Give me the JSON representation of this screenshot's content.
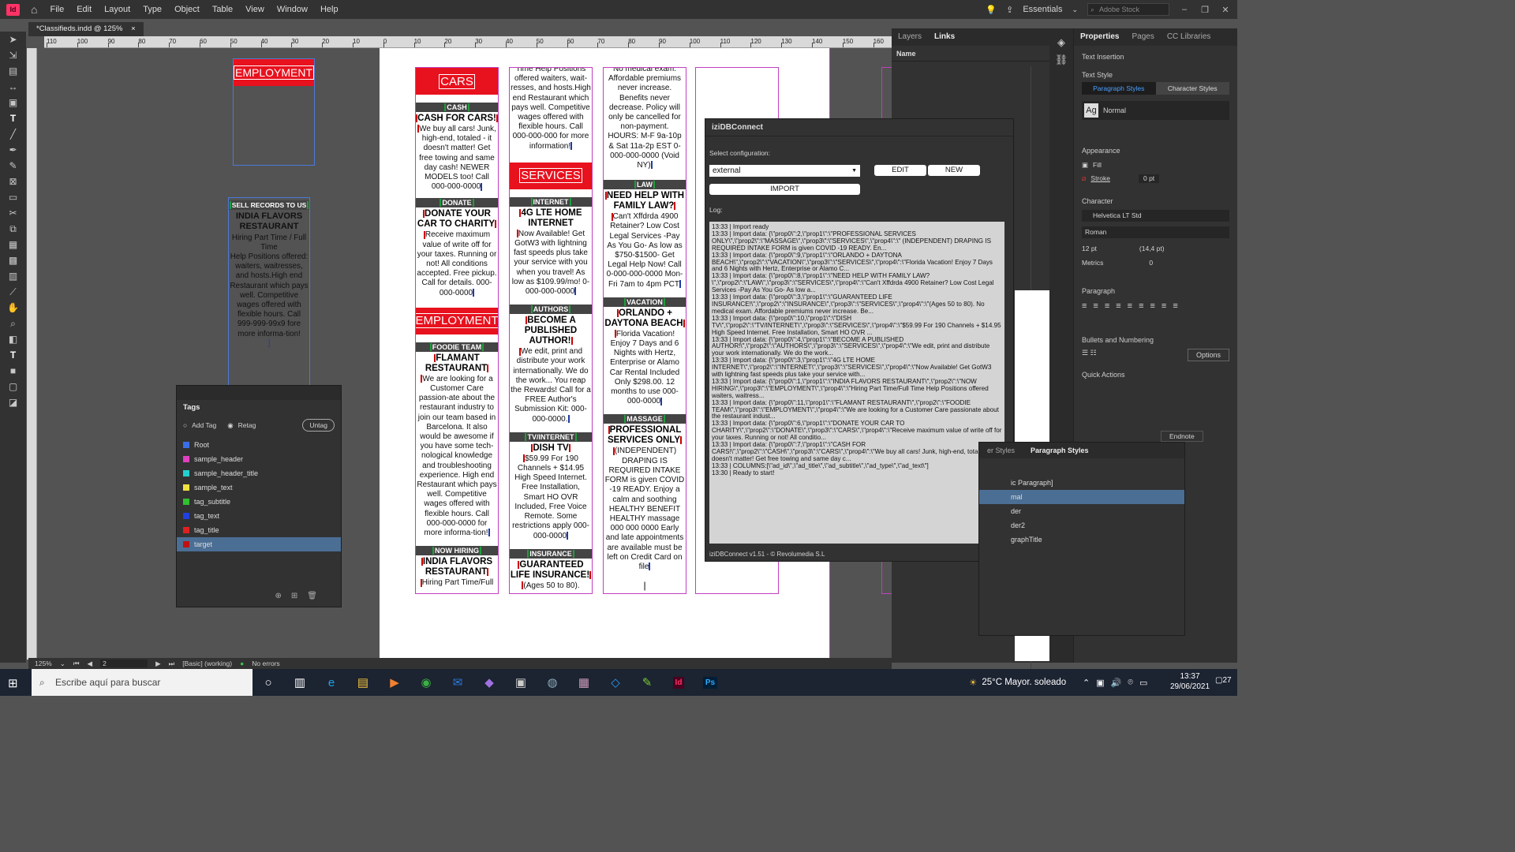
{
  "menubar": {
    "app_logo": "Id",
    "items": [
      "File",
      "Edit",
      "Layout",
      "Type",
      "Object",
      "Table",
      "View",
      "Window",
      "Help"
    ],
    "workspace": "Essentials",
    "stock_placeholder": "Adobe Stock"
  },
  "document": {
    "tab_title": "*Classifieds.indd @ 125%",
    "close": "×"
  },
  "ruler_h": [
    "110",
    "100",
    "90",
    "80",
    "70",
    "60",
    "50",
    "40",
    "30",
    "20",
    "10",
    "0",
    "10",
    "20",
    "30",
    "40",
    "50",
    "60",
    "70",
    "80",
    "90",
    "100",
    "110",
    "120",
    "130",
    "140",
    "150",
    "160"
  ],
  "pasteboard": {
    "employment_block_title": "EMPLOYMENT",
    "sell_block": {
      "kicker": "SELL RECORDS TO US",
      "title": "INDIA FLAVORS RESTAURANT",
      "subtitle": "Hiring Part Time / Full Time",
      "text": "Help Positions offered: waiters, waitresses, and hosts.High end Restaurant which pays well. Competitive wages offered with flexible hours. Call 999-999-99x9 fore more informa-tion!"
    }
  },
  "columns": {
    "col1": {
      "header": "CARS",
      "ads": [
        {
          "kicker": "CASH",
          "title": "CASH FOR CARS!",
          "text": "We buy all cars! Junk, high-end, totaled - it doesn't matter! Get free towing and same day cash! NEWER MODELS too!  Call 000-000-0000"
        },
        {
          "kicker": "DONATE",
          "title": "DONATE YOUR CAR TO CHARITY",
          "text": "Receive maximum value of write off for your taxes.  Running or not! All conditions accepted. Free pickup. Call for details. 000-000-0000"
        }
      ],
      "header2": "EMPLOYMENT",
      "ads2": [
        {
          "kicker": "FOODIE TEAM",
          "title": "FLAMANT RESTAURANT",
          "text": "We are looking for a Customer Care passion-ate about the restaurant industry to join our team based in Barcelona. It also would be awesome if you have some tech-nological knowledge and troubleshooting experience. High end Restaurant which pays well. Competitive wages offered with flexible hours. Call 000-000-0000 for more informa-tion!"
        },
        {
          "kicker": "NOW HIRING",
          "title": "INDIA FLAVORS RESTAURANT",
          "text": "Hiring Part Time/Full"
        }
      ]
    },
    "col2": {
      "top_text": "Time Help Positions offered waiters, wait-resses, and hosts.High end Restaurant which pays well. Competitive wages offered with flexible hours. Call 000-000-000 for more information!",
      "header": "SERVICES",
      "ads": [
        {
          "kicker": "INTERNET",
          "title": "4G LTE HOME INTERNET",
          "text": "Now Available! Get GotW3 with lightning fast speeds plus take your service with you when you travel! As low as $109.99/mo!  0-000-000-0000"
        },
        {
          "kicker": "AUTHORS",
          "title": "BECOME A PUBLISHED AUTHOR!",
          "text": "We edit, print and distribute your work internationally. We do the work... You reap the Rewards! Call for a FREE Author's Submission Kit:  000-000-0000."
        },
        {
          "kicker": "TV/INTERNET",
          "title": "DISH TV",
          "text": "$59.99 For 190 Channels + $14.95 High Speed Internet. Free Installation,  Smart HO OVR Included, Free Voice Remote. Some restrictions apply 000-000-0000"
        },
        {
          "kicker": "INSURANCE",
          "title": "GUARANTEED LIFE INSURANCE!",
          "text": "(Ages 50 to 80)."
        }
      ]
    },
    "col3": {
      "top_text": "No medical exam. Affordable premiums never increase. Benefits never decrease. Policy will only be cancelled for non-payment. HOURS: M-F 9a-10p & Sat 11a-2p EST  0-000-000-0000 (Void NY)",
      "ads": [
        {
          "kicker": "LAW",
          "title": "NEED HELP WITH FAMILY LAW?",
          "text": "Can't Xffdrda 4900 Retainer? Low Cost Legal Services -Pay As You Go- As low as $750-$1500- Get Legal Help Now!  Call  0-000-000-0000 Mon-Fri 7am to 4pm PCT"
        },
        {
          "kicker": "VACATION",
          "title": "ORLANDO + DAYTONA BEACH",
          "text": "Florida Vacation! Enjoy 7 Days and 6 Nights with Hertz, Enterprise or Alamo Car Rental Included Only $298.00. 12 months to use 000-000-0000"
        },
        {
          "kicker": "MASSAGE",
          "title": "PROFESSIONAL SERVICES ONLY",
          "text": "(INDEPENDENT) DRAPING IS REQUIRED INTAKE FORM is given COVID -19 READY. Enjoy a calm and soothing HEALTHY BENEFIT HEALTHY massage 000 000 0000 Early and late appointments are available must be left on Credit Card on file"
        }
      ]
    }
  },
  "layers_panel": {
    "tabs": [
      "Layers",
      "Links"
    ],
    "active": "Links",
    "column_name": "Name"
  },
  "izidb": {
    "title": "iziDBConnect",
    "select_label": "Select configuration:",
    "config_value": "external",
    "edit": "EDIT",
    "new": "NEW",
    "import": "IMPORT",
    "log_label": "Log:",
    "log": "13:33 | Import ready\n13:33 | Import data: {\\\"prop0\\\":2,\\\"prop1\\\":\\\"PROFESSIONAL SERVICES ONLY\\\",\\\"prop2\\\":\\\"MASSAGE\\\",\\\"prop3\\\":\\\"SERVICES\\\",\\\"prop4\\\":\\\" (INDEPENDENT) DRAPING IS REQUIRED INTAKE FORM is given COVID -19 READY. En...\n13:33 | Import data: {\\\"prop0\\\":9,\\\"prop1\\\":\\\"ORLANDO + DAYTONA BEACH\\\",\\\"prop2\\\":\\\"VACATION\\\",\\\"prop3\\\":\\\"SERVICES\\\",\\\"prop4\\\":\\\"Florida Vacation! Enjoy 7 Days and 6 Nights with Hertz, Enterprise or Alamo C...\n13:33 | Import data: {\\\"prop0\\\":8,\\\"prop1\\\":\\\"NEED HELP WITH FAMILY LAW?\\\",\\\"prop2\\\":\\\"LAW\\\",\\\"prop3\\\":\\\"SERVICES\\\",\\\"prop4\\\":\\\"Can't Xffdrda 4900 Retainer? Low Cost Legal Services -Pay As You Go- As low a...\n13:33 | Import data: {\\\"prop0\\\":3,\\\"prop1\\\":\\\"GUARANTEED LIFE INSURANCE!\\\",\\\"prop2\\\":\\\"INSURANCE\\\",\\\"prop3\\\":\\\"SERVICES\\\",\\\"prop4\\\":\\\"(Ages 50 to 80). No medical exam. Affordable premiums never increase. Be...\n13:33 | Import data: {\\\"prop0\\\":10,\\\"prop1\\\":\\\"DISH TV\\\",\\\"prop2\\\":\\\"TV/INTERNET\\\",\\\"prop3\\\":\\\"SERVICES\\\",\\\"prop4\\\":\\\"$59.99 For 190 Channels + $14.95 High Speed Internet. Free Installation, Smart HO OVR ...\n13:33 | Import data: {\\\"prop0\\\":4,\\\"prop1\\\":\\\"BECOME A PUBLISHED AUTHOR!\\\",\\\"prop2\\\":\\\"AUTHORS\\\",\\\"prop3\\\":\\\"SERVICES\\\",\\\"prop4\\\":\\\"We edit, print and distribute your work internationally. We do the work...\n13:33 | Import data: {\\\"prop0\\\":3,\\\"prop1\\\":\\\"4G LTE HOME INTERNET\\\",\\\"prop2\\\":\\\"INTERNET\\\",\\\"prop3\\\":\\\"SERVICES\\\",\\\"prop4\\\":\\\"Now Available! Get GotW3 with lightning fast speeds plus take your service with...\n13:33 | Import data: {\\\"prop0\\\":1,\\\"prop1\\\":\\\"INDIA FLAVORS RESTAURANT\\\",\\\"prop2\\\":\\\"NOW HIRING\\\",\\\"prop3\\\":\\\"EMPLOYMENT\\\",\\\"prop4\\\":\\\"Hiring Part Time/Full Time Help Positions offered waiters, waitress...\n13:33 | Import data: {\\\"prop0\\\":11,\\\"prop1\\\":\\\"FLAMANT RESTAURANT\\\",\\\"prop2\\\":\\\"FOODIE TEAM\\\",\\\"prop3\\\":\\\"EMPLOYMENT\\\",\\\"prop4\\\":\\\"We are looking for a Customer Care passionate about the restaurant indust...\n13:33 | Import data: {\\\"prop0\\\":6,\\\"prop1\\\":\\\"DONATE YOUR CAR TO CHARITY\\\",\\\"prop2\\\":\\\"DONATE\\\",\\\"prop3\\\":\\\"CARS\\\",\\\"prop4\\\":\\\"Receive maximum value of write off for your taxes. Running or not! All conditio...\n13:33 | Import data: {\\\"prop0\\\":7,\\\"prop1\\\":\\\"CASH FOR CARS!\\\",\\\"prop2\\\":\\\"CASH\\\",\\\"prop3\\\":\\\"CARS\\\",\\\"prop4\\\":\\\"We buy all cars! Junk, high-end, totaled - it doesn't matter! Get free towing and same day c...\n13:33 | COLUMNS:[\\\"ad_id\\\",\\\"ad_title\\\",\\\"ad_subtitle\\\",\\\"ad_type\\\",\\\"ad_text\\\"]\n13:30 | Ready to start!",
    "footer": "iziDBConnect v1.51 - © Revolumedia S.L"
  },
  "tags": {
    "title": "Tags",
    "add_tag": "Add Tag",
    "retag": "Retag",
    "untag": "Untag",
    "items": [
      {
        "name": "Root",
        "color": "#3a6ee8"
      },
      {
        "name": "sample_header",
        "color": "#e040c0"
      },
      {
        "name": "sample_header_title",
        "color": "#22d0d0"
      },
      {
        "name": "sample_text",
        "color": "#f0e040"
      },
      {
        "name": "tag_subtitle",
        "color": "#30c030"
      },
      {
        "name": "tag_text",
        "color": "#2040e0"
      },
      {
        "name": "tag_title",
        "color": "#e02020"
      },
      {
        "name": "target",
        "color": "#c01010"
      }
    ],
    "selected": "target"
  },
  "properties": {
    "tabs": [
      "Properties",
      "Pages",
      "CC Libraries"
    ],
    "section_text_insertion": "Text Insertion",
    "text_style": "Text Style",
    "style_tabs": [
      "Paragraph Styles",
      "Character Styles"
    ],
    "style_value": "Normal",
    "appearance": "Appearance",
    "fill": "Fill",
    "stroke": "Stroke",
    "stroke_value": "0 pt",
    "character": "Character",
    "font": "Helvetica LT Std",
    "font_style": "Roman",
    "font_size": "12 pt",
    "leading": "(14,4 pt)",
    "kerning": "Metrics",
    "tracking": "0",
    "paragraph": "Paragraph",
    "bullets": "Bullets and Numbering",
    "options": "Options",
    "quick_actions": "Quick Actions",
    "endnote": "Endnote"
  },
  "parastyles": {
    "tab_left": "er Styles",
    "tab_active": "Paragraph Styles",
    "items": [
      "ic Paragraph]",
      "mal",
      "der",
      "der2",
      "graphTitle"
    ],
    "selected": "mal"
  },
  "statusbar": {
    "zoom": "125%",
    "page": "2",
    "style": "[Basic] (working)",
    "errors": "No errors"
  },
  "taskbar": {
    "search": "Escribe aquí para buscar",
    "weather": "25°C  Mayor. soleado",
    "time": "13:37",
    "date": "29/06/2021",
    "notif": "27"
  }
}
